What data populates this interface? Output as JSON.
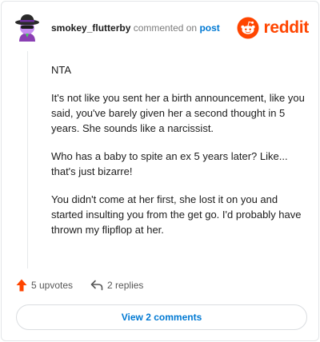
{
  "comment": {
    "username": "smokey_flutterby",
    "action_text": "commented on",
    "post_link": "post",
    "paragraphs": [
      "NTA",
      "It's not like you sent her a birth announcement, like you said, you've barely given her a second thought in 5 years. She sounds like a narcissist.",
      "Who has a baby to spite an ex 5 years later? Like... that's just bizarre!",
      "You didn't come at her first, she lost it on you and started insulting you from the get go. I'd probably have thrown my flipflop at her."
    ]
  },
  "brand": {
    "name": "reddit",
    "color": "#ff4500",
    "icon": "reddit-snoo-icon"
  },
  "stats": {
    "upvotes": "5 upvotes",
    "replies": "2 replies",
    "upvote_icon": "upvote-arrow-icon",
    "reply_icon": "reply-arrow-icon"
  },
  "view_button": {
    "label": "View 2 comments"
  },
  "colors": {
    "link": "#0079d3",
    "upvote": "#ff4500",
    "text": "#1c1c1c"
  }
}
